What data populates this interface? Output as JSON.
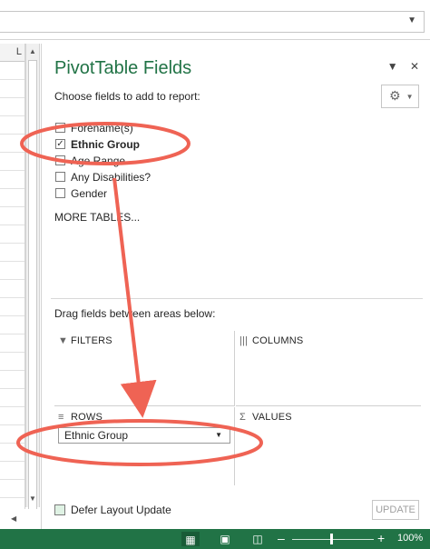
{
  "sheet": {
    "column_header": "L"
  },
  "pane": {
    "title": "PivotTable Fields",
    "choose_label": "Choose fields to add to report:",
    "fields": [
      {
        "label": "Forename(s)",
        "checked": false
      },
      {
        "label": "Ethnic Group",
        "checked": true
      },
      {
        "label": "Age Range",
        "checked": false
      },
      {
        "label": "Any Disabilities?",
        "checked": false
      },
      {
        "label": "Gender",
        "checked": false
      }
    ],
    "more_tables": "MORE TABLES...",
    "drag_label": "Drag fields between areas below:",
    "areas": {
      "filters": "FILTERS",
      "columns": "COLUMNS",
      "rows": "ROWS",
      "values": "VALUES"
    },
    "rows_item": "Ethnic Group",
    "defer_label": "Defer Layout Update",
    "update_label": "UPDATE"
  },
  "status": {
    "zoom": "100%"
  },
  "annotation_color": "#ef6354"
}
